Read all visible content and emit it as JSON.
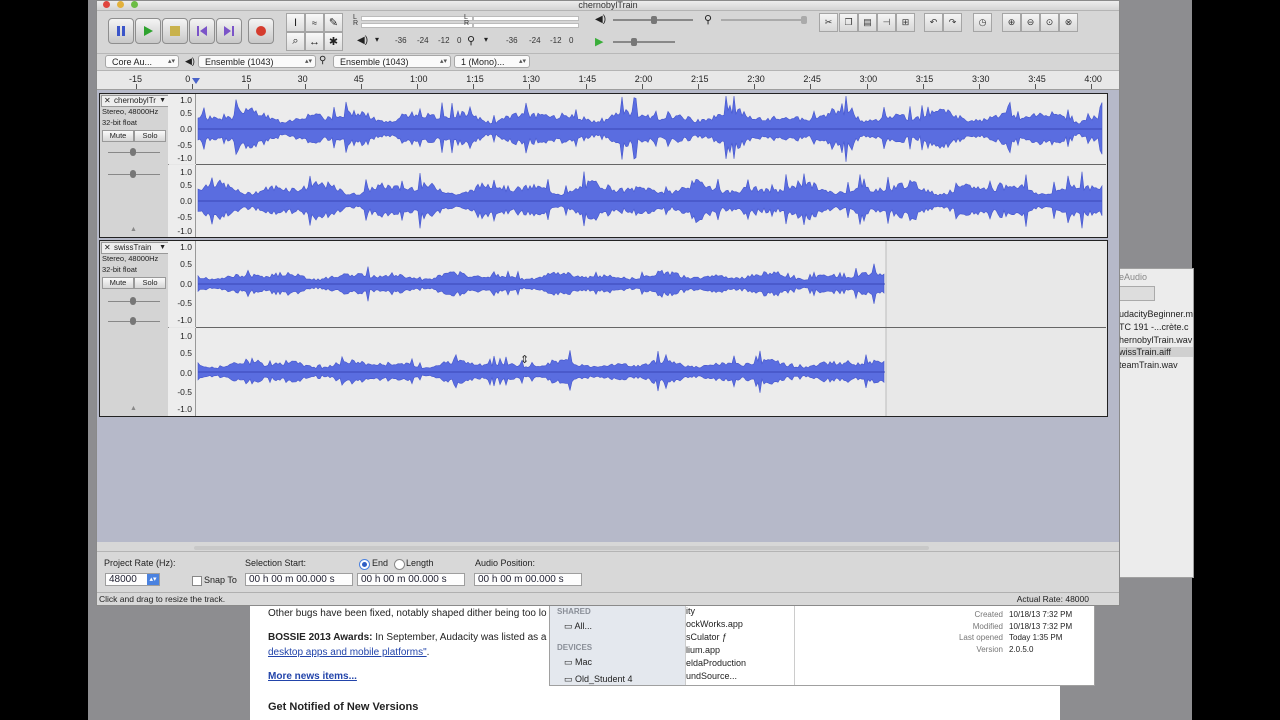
{
  "window": {
    "title": "chernobylTrain"
  },
  "toolbar": {
    "meter_rec_scale": [
      "-36",
      "-24",
      "-12",
      "0"
    ],
    "meter_play_scale": [
      "-36",
      "-24",
      "-12",
      "0"
    ],
    "meter_channels": [
      "L",
      "R"
    ]
  },
  "devices": {
    "host": "Core Au...",
    "recording_device": "Ensemble (1043)",
    "playback_device": "Ensemble (1043)",
    "channels": "1 (Mono)..."
  },
  "ruler": {
    "labels": [
      "-15",
      "0",
      "15",
      "30",
      "45",
      "1:00",
      "1:15",
      "1:30",
      "1:45",
      "2:00",
      "2:15",
      "2:30",
      "2:45",
      "3:00",
      "3:15",
      "3:30",
      "3:45",
      "4:00"
    ]
  },
  "tracks": [
    {
      "name": "chernobylTr",
      "format": "Stereo, 48000Hz",
      "bitdepth": "32-bit float",
      "mute": "Mute",
      "solo": "Solo",
      "scale": [
        "1.0",
        "0.5",
        "0.0",
        "-0.5",
        "-1.0"
      ],
      "length_fraction": 1.0
    },
    {
      "name": "swissTrain",
      "format": "Stereo, 48000Hz",
      "bitdepth": "32-bit float",
      "mute": "Mute",
      "solo": "Solo",
      "scale": [
        "1.0",
        "0.5",
        "0.0",
        "-0.5",
        "-1.0"
      ],
      "length_fraction": 0.76
    }
  ],
  "selection_bar": {
    "project_rate_label": "Project Rate (Hz):",
    "project_rate": "48000",
    "snap_to": "Snap To",
    "selection_start_label": "Selection Start:",
    "end_label": "End",
    "length_label": "Length",
    "audio_position_label": "Audio Position:",
    "start_time": "00 h 00 m 00.000 s",
    "end_time": "00 h 00 m 00.000 s",
    "position_time": "00 h 00 m 00.000 s"
  },
  "status": {
    "message": "Click and drag to resize the track.",
    "actual_rate": "Actual Rate: 48000"
  },
  "background": {
    "browser": {
      "line1": "Other bugs have been fixed, notably shaped dither being too lo",
      "line2_bold": "BOSSIE 2013 Awards:",
      "line2": " In September, Audacity was listed as a",
      "line3_link": "desktop apps and mobile platforms\"",
      "line3_end": ".",
      "more": "More news items...",
      "cut": "Get Notified of New Versions"
    },
    "finder": {
      "shared": "SHARED",
      "all": "All...",
      "devices": "DEVICES",
      "mac": "Mac",
      "old": "Old_Student 4",
      "col_items": [
        "ity",
        "ockWorks.app",
        "sCulator ƒ",
        "lium.app",
        "eldaProduction",
        "undSource..."
      ],
      "info_labels": [
        "Created",
        "Modified",
        "Last opened",
        "Version"
      ],
      "info_values": [
        "10/18/13 7:32 PM",
        "10/18/13 7:32 PM",
        "Today 1:35 PM",
        "2.0.5.0"
      ]
    },
    "right_window": {
      "title": "eAudio",
      "items": [
        "udacityBeginner.m",
        "TC 191 -...crète.c",
        "hernobylTrain.wav",
        "wissTrain.aiff",
        "teamTrain.wav"
      ]
    }
  }
}
